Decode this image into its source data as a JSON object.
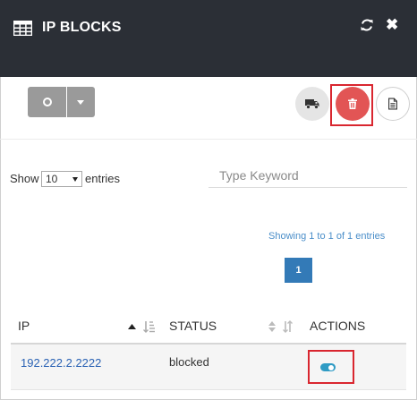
{
  "header": {
    "title": "IP BLOCKS",
    "title_icon": "table-grid-icon",
    "refresh_icon": "refresh-icon",
    "close_icon": "close-icon",
    "close_glyph": "✖"
  },
  "toolbar": {
    "left_buttons": [
      "circle-icon",
      "caret-down-icon"
    ],
    "right_buttons": [
      "truck-icon",
      "trash-icon",
      "document-icon"
    ]
  },
  "table_controls": {
    "show_label": "Show",
    "page_length": "10",
    "entries_label": "entries",
    "search_placeholder": "Type Keyword",
    "info": "Showing 1 to 1 of 1 entries",
    "current_page": "1"
  },
  "table": {
    "columns": [
      "IP",
      "STATUS",
      "ACTIONS"
    ],
    "rows": [
      {
        "ip": "192.222.2.2222",
        "status": "blocked",
        "action": "toggle-icon"
      }
    ]
  },
  "colors": {
    "header_bg": "#2b2f36",
    "delete_button": "#e25555",
    "highlight": "#d9262f",
    "pagination": "#337ab7",
    "toggle": "#2f9bc4",
    "link": "#2a62b4"
  }
}
